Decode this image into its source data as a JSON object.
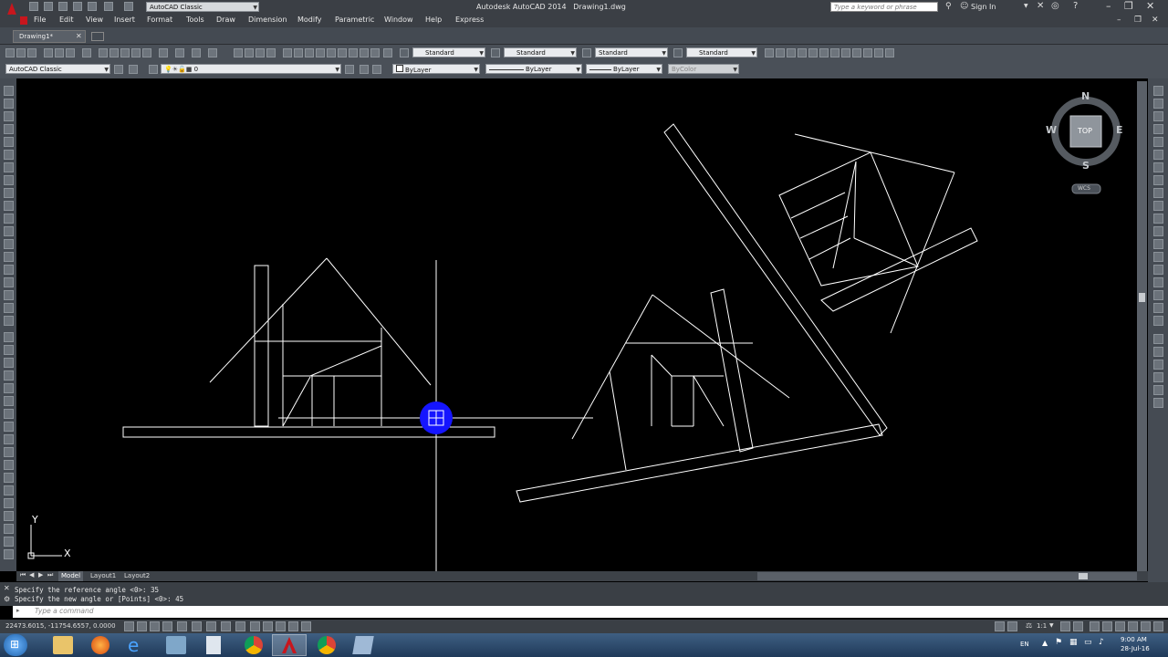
{
  "window": {
    "title": "Autodesk AutoCAD 2014",
    "file": "Drawing1.dwg",
    "workspace": "AutoCAD Classic",
    "search_placeholder": "Type a keyword or phrase",
    "sign_in": "Sign In"
  },
  "menu": [
    "File",
    "Edit",
    "View",
    "Insert",
    "Format",
    "Tools",
    "Draw",
    "Dimension",
    "Modify",
    "Parametric",
    "Window",
    "Help",
    "Express"
  ],
  "doc_tab": "Drawing1*",
  "styles": {
    "text_style": "Standard",
    "dim_style": "Standard",
    "table_style": "Standard",
    "multileader_style": "Standard"
  },
  "properties": {
    "workspace": "AutoCAD Classic",
    "layer": "0",
    "color": "ByLayer",
    "linetype": "ByLayer",
    "lineweight": "ByLayer",
    "plotstyle": "ByColor"
  },
  "viewcube": {
    "n": "N",
    "s": "S",
    "e": "E",
    "w": "W",
    "face": "TOP",
    "ucs": "WCS"
  },
  "ucs_icon": {
    "x": "X",
    "y": "Y"
  },
  "layouts": [
    "Model",
    "Layout1",
    "Layout2"
  ],
  "command": {
    "history": [
      "Specify the reference angle <0>: 35",
      "Specify the new angle or [Points] <0>: 45"
    ],
    "placeholder": "Type a command"
  },
  "status": {
    "coords": "22473.6015, -11754.6557, 0.0000",
    "scale": "1:1",
    "lang": "EN",
    "time": "9:00 AM",
    "date": "28-Jul-16"
  },
  "colors": {
    "chrome": "#3b3f45",
    "canvas": "#000000",
    "cursor_highlight": "#1515ff",
    "app_red": "#c8161d"
  }
}
